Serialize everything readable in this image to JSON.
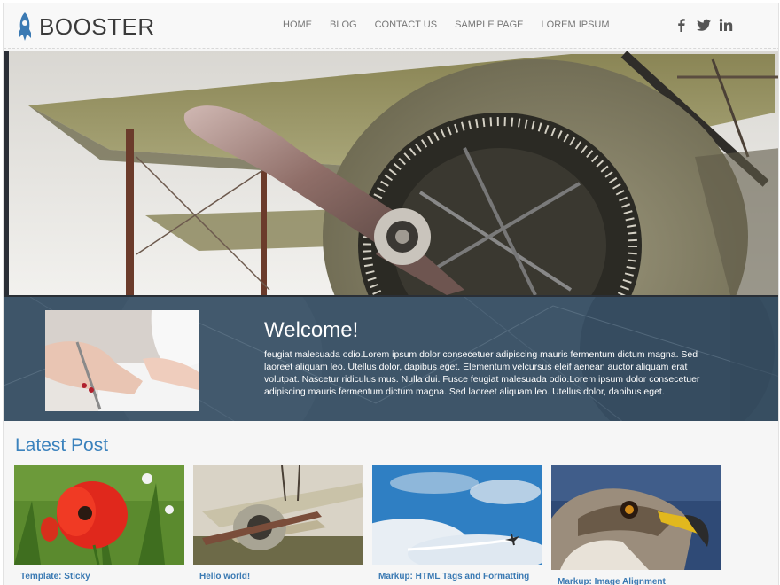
{
  "header": {
    "logo_text": "BOOSTER",
    "nav": [
      "HOME",
      "BLOG",
      "CONTACT US",
      "SAMPLE PAGE",
      "LOREM IPSUM"
    ],
    "social": [
      "facebook-icon",
      "twitter-icon",
      "linkedin-icon"
    ]
  },
  "welcome": {
    "title": "Welcome!",
    "text": "feugiat malesuada odio.Lorem ipsum dolor consecetuer adipiscing mauris fermentum dictum magna. Sed laoreet aliquam leo. Utellus dolor, dapibus eget. Elementum velcursus eleif aenean auctor aliquam erat volutpat. Nascetur ridiculus mus. Nulla dui. Fusce feugiat malesuada odio.Lorem ipsum dolor consecetuer adipiscing mauris fermentum dictum magna. Sed laoreet aliquam leo. Utellus dolor, dapibus eget."
  },
  "latest": {
    "title": "Latest Post",
    "posts": [
      {
        "title": "Template: Sticky"
      },
      {
        "title": "Hello world!"
      },
      {
        "title": "Markup: HTML Tags and Formatting"
      },
      {
        "title": "Markup: Image Alignment"
      }
    ]
  },
  "colors": {
    "accent": "#3b82bd",
    "welcome_bg": "#3d5468",
    "logo": "#3b7ab3"
  }
}
